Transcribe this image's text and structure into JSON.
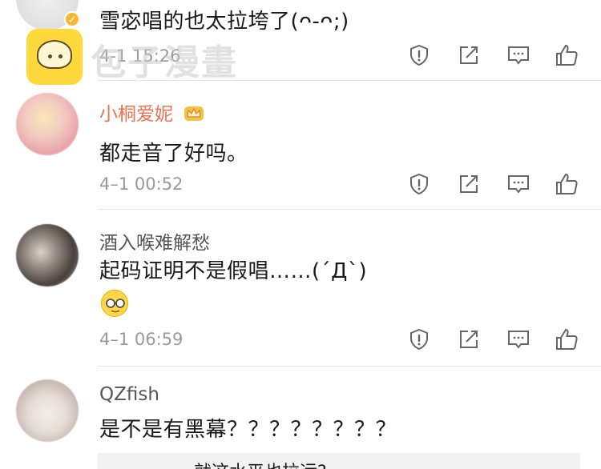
{
  "comments": [
    {
      "username": "",
      "text": "雪宓唱的也太拉垮了(ᴖ-ᴖ;)",
      "time": "4-1 15:26"
    },
    {
      "username": "小桐爱妮",
      "text": "都走音了好吗。",
      "time": "4–1 00:52"
    },
    {
      "username": "酒入喉难解愁",
      "text": "起码证明不是假唱……(´Д`)",
      "time": "4–1 06:59"
    },
    {
      "username": "QZfish",
      "text": "是不是有黑幕？？？？？？？？",
      "time": ""
    }
  ],
  "reply_preview": "就这水平也拉运?",
  "watermark": {
    "text": "包子漫畫"
  },
  "icons": {
    "report": "report-icon",
    "share": "share-icon",
    "reply": "reply-icon",
    "like": "thumbs-up-icon",
    "verified": "verified-icon",
    "crown": "vip-crown-icon",
    "emoji": "glasses-emoji-icon"
  },
  "colors": {
    "vip_name": "#eb7350",
    "normal_name": "#555555",
    "time": "#9a9a9a",
    "verified_badge": "#f7b731"
  }
}
